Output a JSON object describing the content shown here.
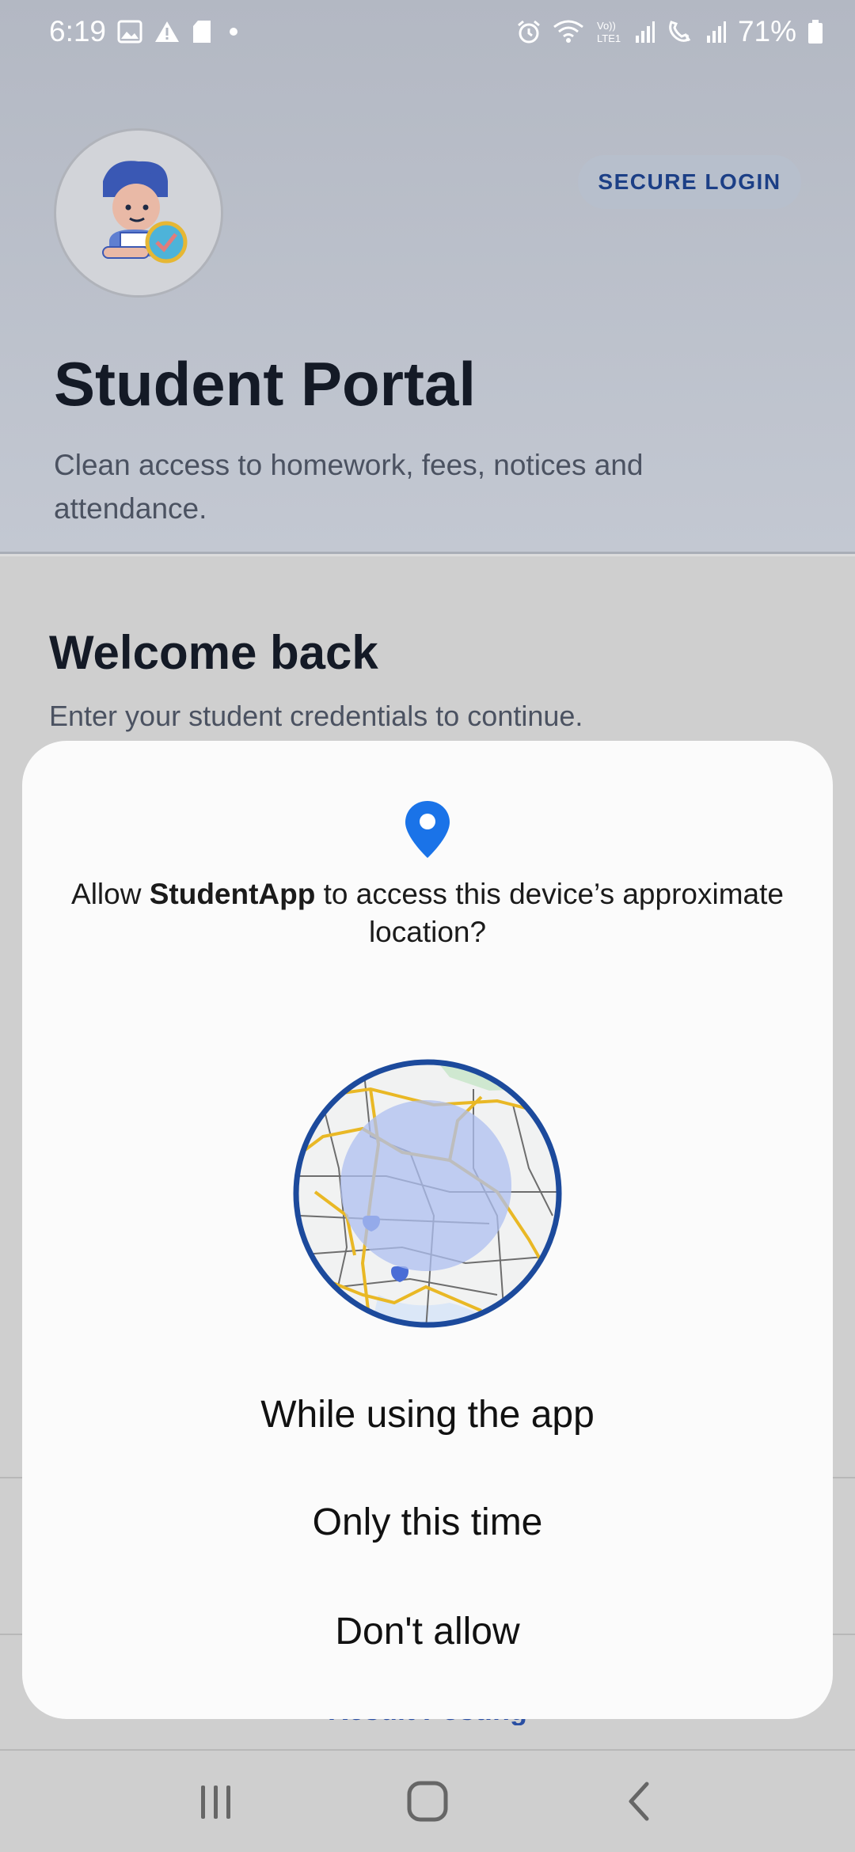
{
  "status_bar": {
    "time": "6:19",
    "battery": "71%",
    "icons": [
      "gallery-icon",
      "alert-icon",
      "sd-card-icon",
      "alarm-icon",
      "wifi-icon",
      "volte-icon",
      "signal-icon",
      "wifi-calling-icon",
      "signal-icon",
      "battery-icon"
    ]
  },
  "hero": {
    "badge": "SECURE LOGIN",
    "title": "Student Portal",
    "subtitle": "Clean access to homework, fees, notices and attendance."
  },
  "login": {
    "title": "Welcome back",
    "subtitle": "Enter your student credentials to continue."
  },
  "background_link": "Result Posting",
  "dialog": {
    "prompt_prefix": "Allow ",
    "app_name": "StudentApp",
    "prompt_suffix": " to access this device’s approximate location?",
    "options": {
      "while_using": "While using the app",
      "only_once": "Only this time",
      "deny": "Don't allow"
    }
  },
  "colors": {
    "accent_blue": "#1a73e8",
    "map_ring": "#1c4a9c",
    "map_circle": "#aebff0",
    "badge_text": "#1c3f86"
  },
  "nav": {
    "icons": [
      "recents-icon",
      "home-icon",
      "back-icon"
    ]
  }
}
